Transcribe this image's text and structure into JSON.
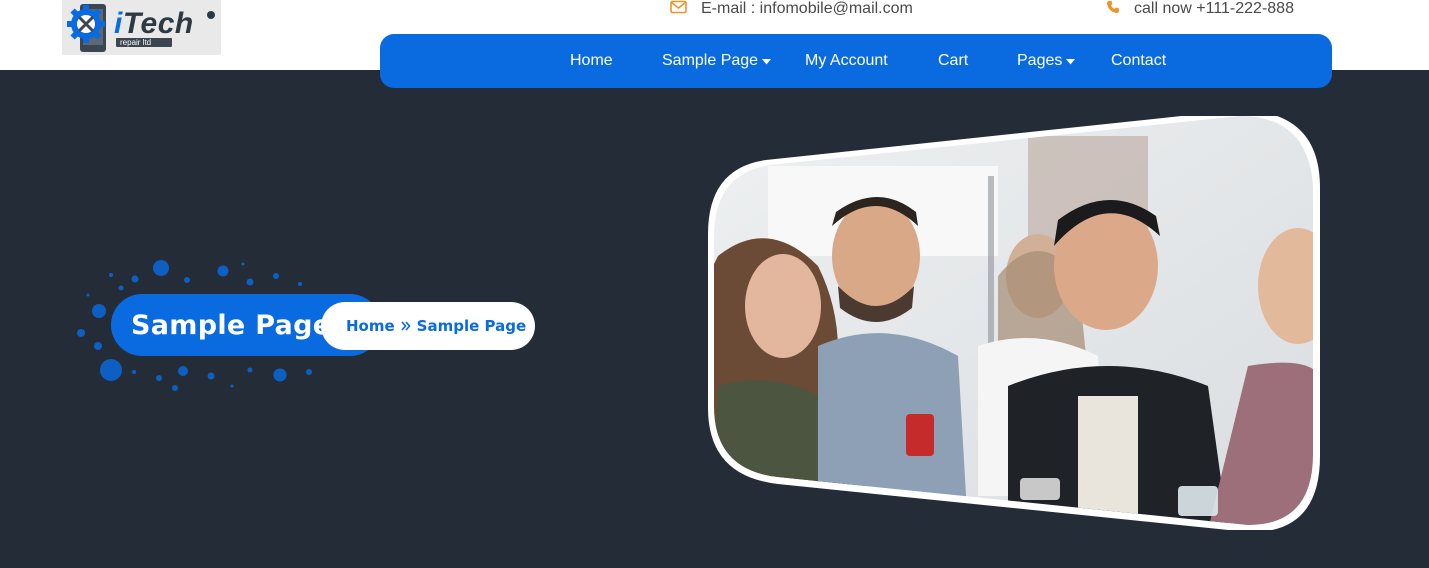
{
  "header": {
    "logo": {
      "brand_i": "i",
      "brand_rest": "Tech",
      "tagline": "repair ltd"
    },
    "email": {
      "icon": "envelope-icon",
      "text": "E-mail : infomobile@mail.com"
    },
    "phone": {
      "icon": "phone-icon",
      "text": "call now +111-222-888"
    }
  },
  "nav": {
    "items": [
      {
        "label": "Home",
        "dropdown": false
      },
      {
        "label": "Sample Page",
        "dropdown": true
      },
      {
        "label": "My Account",
        "dropdown": false
      },
      {
        "label": "Cart",
        "dropdown": false
      },
      {
        "label": "Pages",
        "dropdown": true
      },
      {
        "label": "Contact",
        "dropdown": false
      }
    ]
  },
  "hero": {
    "title": "Sample Page",
    "breadcrumb": {
      "home": "Home",
      "separator_icon": "double-chevron-right-icon",
      "current": "Sample Page"
    }
  },
  "colors": {
    "accent": "#0a6be0",
    "hero_bg": "#242d37",
    "contact_icon": "#f0922a"
  }
}
